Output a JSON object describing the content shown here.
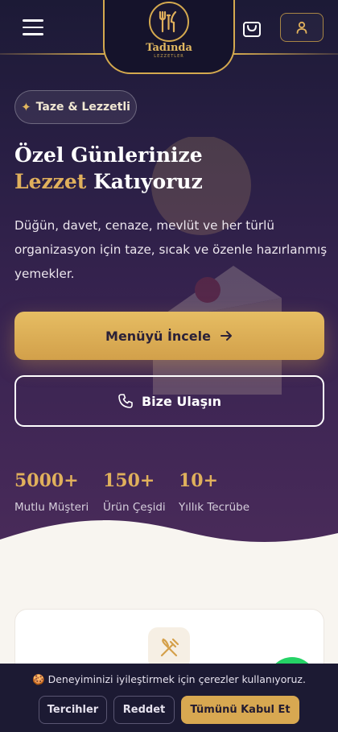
{
  "header": {
    "logo_name": "Tadında",
    "logo_sub": "LEZZETLER"
  },
  "hero": {
    "badge": "Taze & Lezzetli",
    "title_line1": "Özel Günlerinize",
    "title_highlight": "Lezzet",
    "title_rest": "Katıyoruz",
    "description": "Düğün, davet, cenaze, mevlüt ve her türlü organizasyon için taze, sıcak ve özenle hazırlanmış yemekler.",
    "primary_button": "Menüyü İncele",
    "secondary_button": "Bize Ulaşın"
  },
  "stats": [
    {
      "value": "5000+",
      "label": "Mutlu Müşteri"
    },
    {
      "value": "150+",
      "label": "Ürün Çeşidi"
    },
    {
      "value": "10+",
      "label": "Yıllık Tecrübe"
    }
  ],
  "cookie": {
    "emoji": "🍪",
    "text": "Deneyiminizi iyileştirmek için çerezler kullanıyoruz.",
    "preferences": "Tercihler",
    "reject": "Reddet",
    "accept": "Tümünü Kabul Et"
  },
  "colors": {
    "gold": "#e0b05c",
    "hero_bg": "#2a1f45",
    "whatsapp": "#25d366"
  },
  "icons": [
    "menu-icon",
    "fork-knife-icon",
    "cart-icon",
    "user-icon",
    "arrow-right-icon",
    "phone-icon",
    "whatsapp-icon"
  ]
}
